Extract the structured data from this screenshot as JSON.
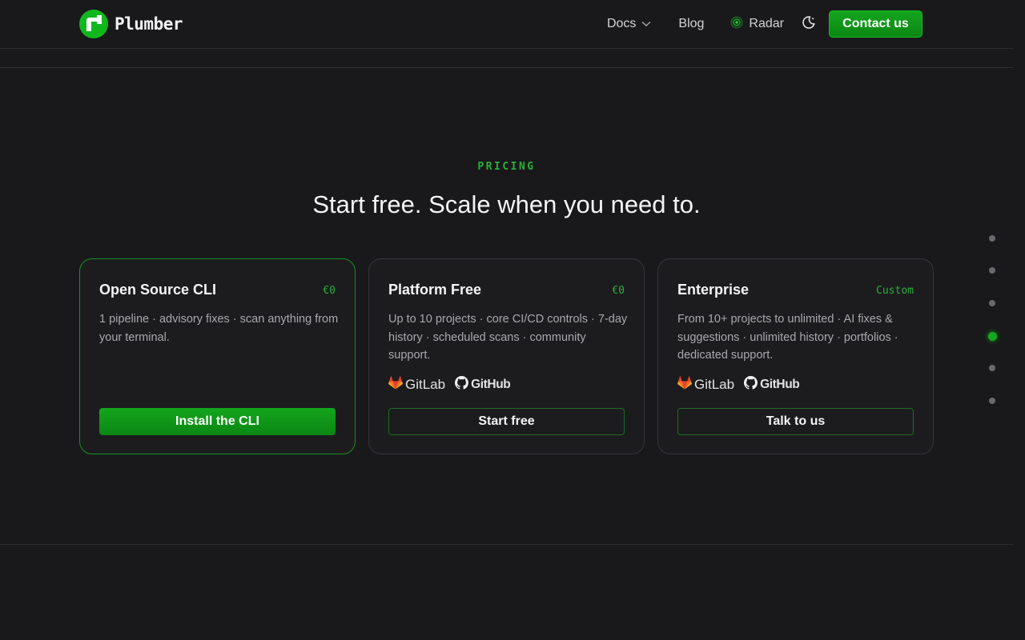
{
  "brand": {
    "name": "Plumber",
    "accent": "#11b81d"
  },
  "nav": {
    "docs": "Docs",
    "blog": "Blog",
    "radar": "Radar",
    "contact": "Contact us"
  },
  "pricing": {
    "eyebrow": "PRICING",
    "title": "Start free. Scale when you need to.",
    "plans": [
      {
        "name": "Open Source CLI",
        "price": "€0",
        "description": "1 pipeline · advisory fixes · scan anything from your terminal.",
        "button": "Install the CLI"
      },
      {
        "name": "Platform Free",
        "price": "€0",
        "description": "Up to 10 projects · core CI/CD controls · 7-day history · scheduled scans · community support.",
        "providers": [
          "GitLab",
          "GitHub"
        ],
        "button": "Start free"
      },
      {
        "name": "Enterprise",
        "price": "Custom",
        "description": "From 10+ projects to unlimited · AI fixes & suggestions · unlimited history · portfolios · dedicated support.",
        "providers": [
          "GitLab",
          "GitHub"
        ],
        "button": "Talk to us"
      }
    ]
  },
  "section_nav": {
    "count": 6,
    "active_index": 3
  }
}
